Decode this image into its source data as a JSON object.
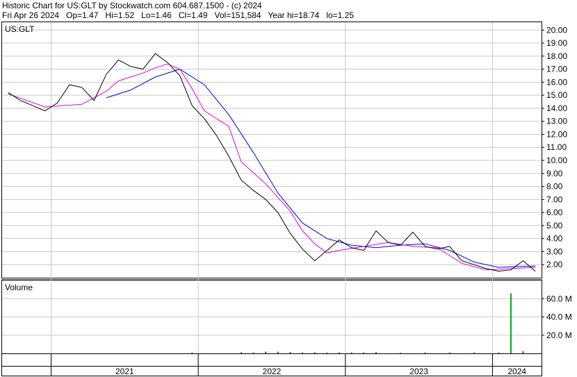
{
  "header": {
    "line1": "Historic Chart for US:GLT by Stockwatch.com 604.687.1500 - (c) 2024",
    "line2": "Fri Apr 26 2024   Op=1.47   Hi=1.52   Lo=1.46   Cl=1.49   Vol=151,584   Year hi=18.74   lo=1.25"
  },
  "chart_data": [
    {
      "type": "line",
      "symbol_label": "US:GLT",
      "x_axis_labels": [
        "2021",
        "2022",
        "2023",
        "2024"
      ],
      "y_ticks": [
        "20.00",
        "19.00",
        "18.00",
        "17.00",
        "16.00",
        "15.00",
        "14.00",
        "13.00",
        "12.00",
        "11.00",
        "10.00",
        "9.00",
        "8.00",
        "7.00",
        "6.00",
        "5.00",
        "4.00",
        "3.00",
        "2.00"
      ],
      "ylim": [
        1.0,
        20.6
      ],
      "x_range_months": [
        "2020-09",
        "2024-04"
      ],
      "colors": {
        "price": "#000000",
        "ma_short": "#e000e0",
        "ma_long": "#0000e0"
      },
      "series": [
        {
          "key": "price",
          "x": [
            "2020-09",
            "2020-10",
            "2020-11",
            "2020-12",
            "2021-01",
            "2021-02",
            "2021-03",
            "2021-04",
            "2021-05",
            "2021-06",
            "2021-07",
            "2021-08",
            "2021-09",
            "2021-10",
            "2021-11",
            "2021-12",
            "2022-01",
            "2022-02",
            "2022-03",
            "2022-04",
            "2022-05",
            "2022-06",
            "2022-07",
            "2022-08",
            "2022-09",
            "2022-10",
            "2022-11",
            "2022-12",
            "2023-01",
            "2023-02",
            "2023-03",
            "2023-04",
            "2023-05",
            "2023-06",
            "2023-07",
            "2023-08",
            "2023-09",
            "2023-10",
            "2023-11",
            "2023-12",
            "2024-01",
            "2024-02",
            "2024-03",
            "2024-04"
          ],
          "values": [
            15.2,
            14.6,
            14.2,
            13.8,
            14.4,
            15.8,
            15.6,
            14.6,
            16.6,
            17.7,
            17.2,
            17.0,
            18.2,
            17.5,
            16.5,
            14.2,
            13.2,
            11.9,
            10.3,
            8.5,
            7.7,
            7.0,
            6.0,
            4.4,
            3.2,
            2.3,
            3.1,
            3.9,
            3.3,
            3.1,
            4.6,
            3.7,
            3.5,
            4.5,
            3.4,
            3.2,
            3.4,
            2.3,
            2.0,
            1.7,
            1.5,
            1.6,
            2.3,
            1.5
          ]
        },
        {
          "key": "ma_short",
          "x": [
            "2020-09",
            "2020-12",
            "2021-03",
            "2021-05",
            "2021-06",
            "2021-08",
            "2021-09",
            "2021-10",
            "2021-11",
            "2021-12",
            "2022-01",
            "2022-03",
            "2022-04",
            "2022-06",
            "2022-08",
            "2022-09",
            "2022-10",
            "2022-11",
            "2022-12",
            "2023-02",
            "2023-04",
            "2023-06",
            "2023-08",
            "2023-10",
            "2023-12",
            "2024-02",
            "2024-04"
          ],
          "values": [
            15.1,
            14.1,
            14.3,
            15.3,
            16.1,
            16.7,
            17.1,
            17.4,
            17.0,
            15.5,
            13.8,
            12.6,
            9.9,
            8.2,
            6.1,
            4.6,
            3.6,
            2.9,
            3.1,
            3.4,
            3.7,
            3.4,
            3.3,
            2.1,
            1.6,
            1.7,
            1.8
          ]
        },
        {
          "key": "ma_long",
          "x": [
            "2021-05",
            "2021-07",
            "2021-09",
            "2021-11",
            "2022-01",
            "2022-03",
            "2022-05",
            "2022-07",
            "2022-09",
            "2022-11",
            "2023-01",
            "2023-03",
            "2023-05",
            "2023-07",
            "2023-09",
            "2023-11",
            "2024-01",
            "2024-04"
          ],
          "values": [
            14.8,
            15.4,
            16.4,
            17.0,
            15.8,
            13.5,
            10.6,
            7.5,
            5.2,
            4.0,
            3.5,
            3.3,
            3.5,
            3.6,
            3.1,
            2.2,
            1.8,
            1.9
          ]
        }
      ]
    },
    {
      "type": "bar",
      "title": "Volume",
      "y_ticks": [
        "60.0 M",
        "40.0 M",
        "20.0 M"
      ],
      "ylim": [
        0,
        80
      ],
      "colors": {
        "bar": "#cc2200",
        "spike": "#00aa00"
      },
      "x": [
        "2021-12",
        "2022-04",
        "2022-05",
        "2022-06",
        "2022-07",
        "2022-08",
        "2022-09",
        "2022-10",
        "2022-11",
        "2022-12",
        "2023-01",
        "2023-02",
        "2023-03",
        "2023-05",
        "2023-07",
        "2023-09",
        "2023-11",
        "2024-01",
        "2024-02",
        "2024-03"
      ],
      "values": [
        1.0,
        1.2,
        1.0,
        2.0,
        1.8,
        1.5,
        1.0,
        1.2,
        0.8,
        1.0,
        1.1,
        0.9,
        1.4,
        0.8,
        1.0,
        0.9,
        0.8,
        0.9,
        66.0,
        2.5
      ]
    }
  ]
}
